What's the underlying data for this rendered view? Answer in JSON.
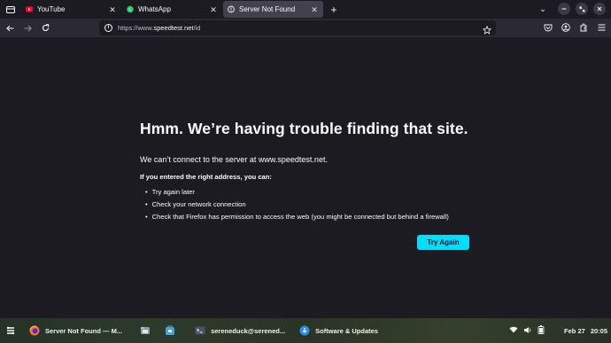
{
  "tabs": [
    {
      "title": "YouTube",
      "favicon": "youtube-icon",
      "color": "#ff0033",
      "active": false
    },
    {
      "title": "WhatsApp",
      "favicon": "whatsapp-icon",
      "color": "#25d366",
      "active": false
    },
    {
      "title": "Server Not Found",
      "favicon": "warning-icon",
      "color": "#fbfbfe",
      "active": true
    }
  ],
  "navbar": {
    "url_prefix": "https://www.",
    "url_host": "speedtest.net",
    "url_path": "/id"
  },
  "error": {
    "title": "Hmm. We’re having trouble finding that site.",
    "description": "We can’t connect to the server at www.speedtest.net.",
    "subtitle": "If you entered the right address, you can:",
    "suggestions": [
      "Try again later",
      "Check your network connection",
      "Check that Firefox has permission to access the web (you might be connected but behind a firewall)"
    ],
    "button_label": "Try Again",
    "accent": "#00ddff"
  },
  "taskbar": {
    "items": [
      {
        "label": "Server Not Found — M...",
        "icon": "firefox-icon"
      },
      {
        "label": "",
        "icon": "files-icon"
      },
      {
        "label": "",
        "icon": "store-icon"
      },
      {
        "label": "sereneduck@serened...",
        "icon": "terminal-icon"
      },
      {
        "label": "Software & Updates",
        "icon": "software-updates-icon"
      }
    ],
    "date": "Feb 27",
    "time": "20:05"
  }
}
